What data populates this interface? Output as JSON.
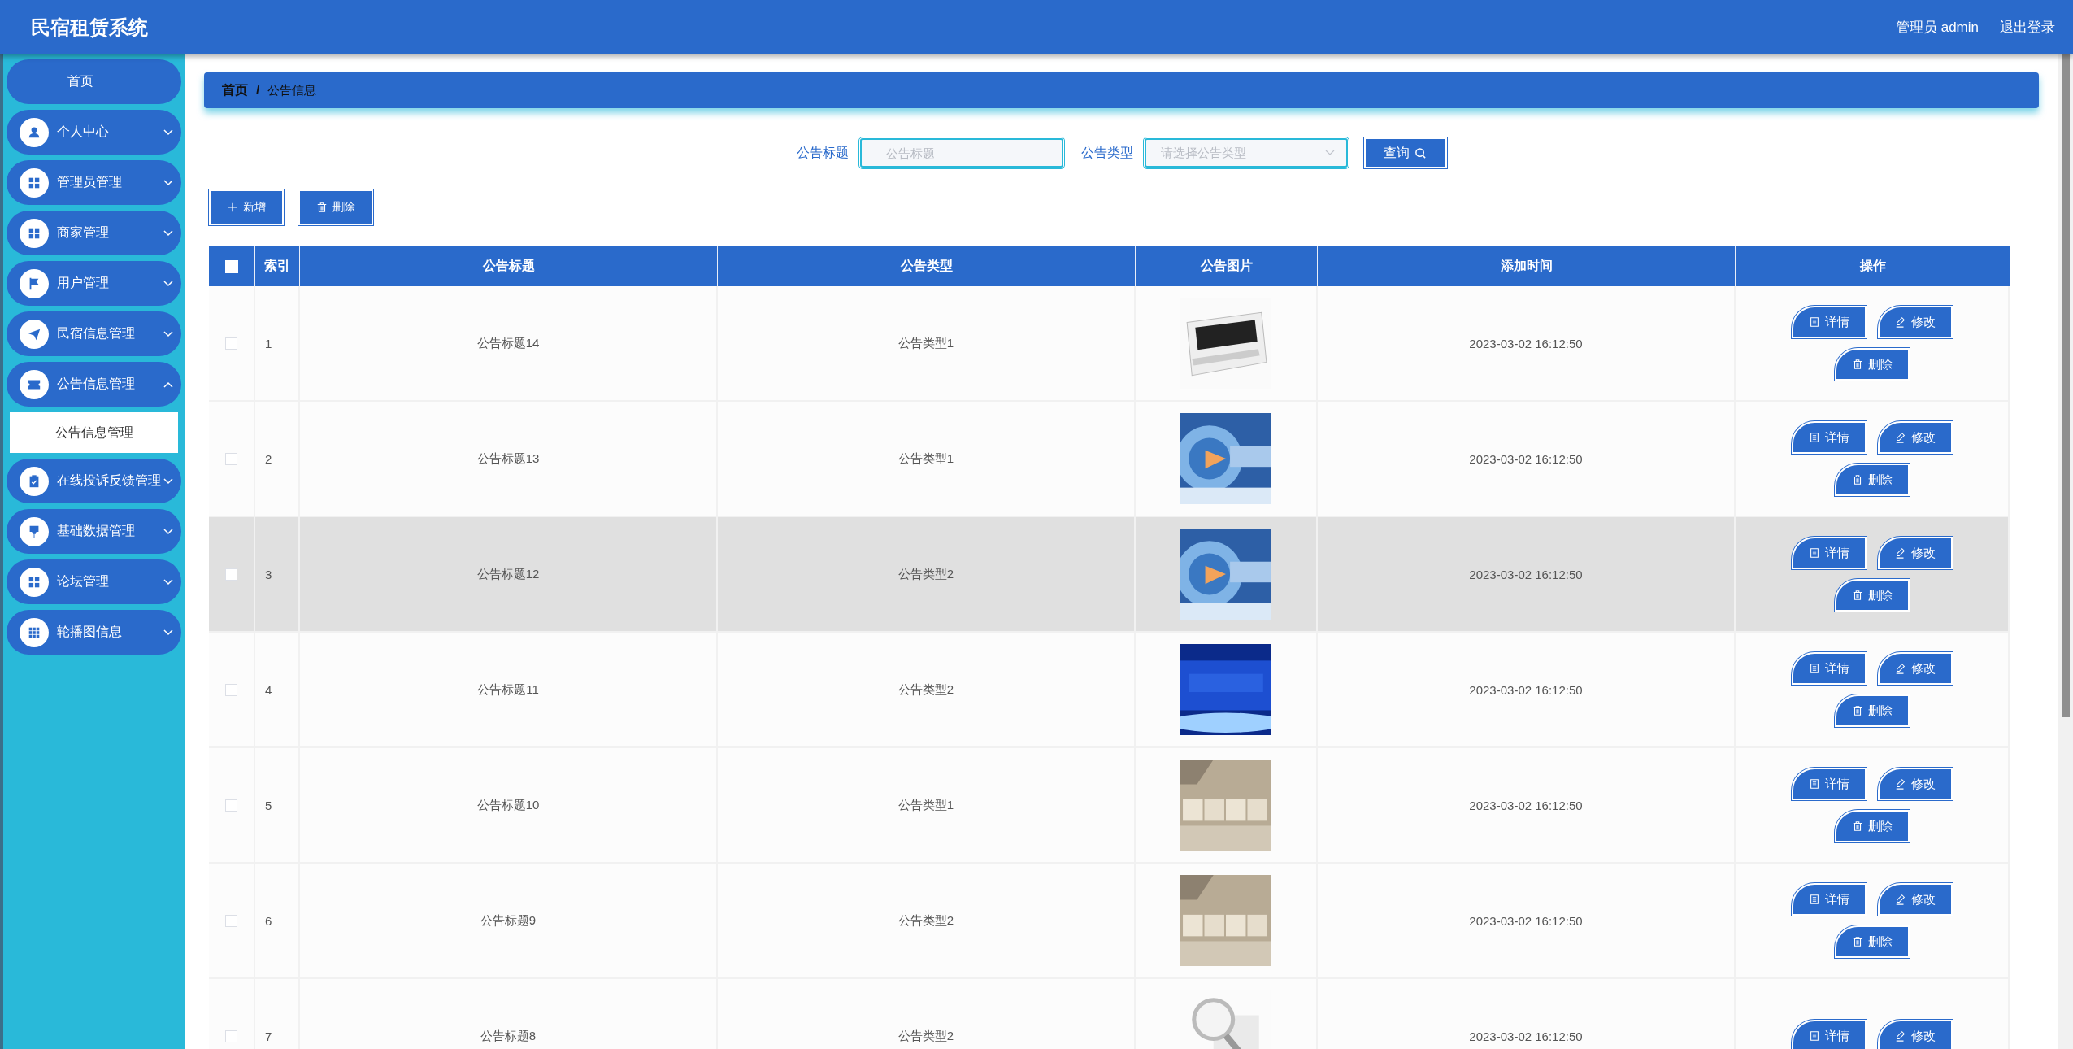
{
  "header": {
    "title": "民宿租赁系统",
    "user": "管理员 admin",
    "logout": "退出登录"
  },
  "sidebar": {
    "items": [
      {
        "kind": "link",
        "label": "首页"
      },
      {
        "kind": "menu",
        "label": "个人中心",
        "expanded": false
      },
      {
        "kind": "menu",
        "label": "管理员管理",
        "expanded": false
      },
      {
        "kind": "menu",
        "label": "商家管理",
        "expanded": false
      },
      {
        "kind": "menu",
        "label": "用户管理",
        "expanded": false
      },
      {
        "kind": "menu",
        "label": "民宿信息管理",
        "expanded": false
      },
      {
        "kind": "menu",
        "label": "公告信息管理",
        "expanded": true,
        "children": [
          {
            "label": "公告信息管理",
            "selected": true
          }
        ]
      },
      {
        "kind": "menu",
        "label": "在线投诉反馈管理",
        "expanded": false
      },
      {
        "kind": "menu",
        "label": "基础数据管理",
        "expanded": false
      },
      {
        "kind": "menu",
        "label": "论坛管理",
        "expanded": false
      },
      {
        "kind": "menu",
        "label": "轮播图信息",
        "expanded": false
      }
    ]
  },
  "breadcrumb": {
    "home": "首页",
    "separator": "/",
    "current": "公告信息"
  },
  "search": {
    "fields": [
      {
        "kind": "input",
        "label": "公告标题",
        "placeholder": "公告标题"
      },
      {
        "kind": "select",
        "label": "公告类型",
        "placeholder": "请选择公告类型"
      }
    ],
    "button": "查询"
  },
  "actions": [
    {
      "kind": "add",
      "label": "新增"
    },
    {
      "kind": "delete",
      "label": "删除"
    }
  ],
  "table": {
    "select_all": {
      "checked": false
    },
    "columns": [
      "索引",
      "公告标题",
      "公告类型",
      "公告图片",
      "添加时间",
      "操作"
    ],
    "rows": [
      {
        "checked": false,
        "hovered": false,
        "index": "1",
        "title": "公告标题14",
        "type": "公告类型1",
        "time": "2023-03-02 16:12:50",
        "actions": [
          {
            "kind": "detail",
            "label": "详情"
          },
          {
            "kind": "edit",
            "label": "修改"
          },
          {
            "kind": "delete",
            "label": "删除"
          }
        ]
      },
      {
        "checked": false,
        "hovered": false,
        "index": "2",
        "title": "公告标题13",
        "type": "公告类型1",
        "time": "2023-03-02 16:12:50",
        "actions": [
          {
            "kind": "detail",
            "label": "详情"
          },
          {
            "kind": "edit",
            "label": "修改"
          },
          {
            "kind": "delete",
            "label": "删除"
          }
        ]
      },
      {
        "checked": false,
        "hovered": true,
        "index": "3",
        "title": "公告标题12",
        "type": "公告类型2",
        "time": "2023-03-02 16:12:50",
        "actions": [
          {
            "kind": "detail",
            "label": "详情"
          },
          {
            "kind": "edit",
            "label": "修改"
          },
          {
            "kind": "delete",
            "label": "删除"
          }
        ]
      },
      {
        "checked": false,
        "hovered": false,
        "index": "4",
        "title": "公告标题11",
        "type": "公告类型2",
        "time": "2023-03-02 16:12:50",
        "actions": [
          {
            "kind": "detail",
            "label": "详情"
          },
          {
            "kind": "edit",
            "label": "修改"
          },
          {
            "kind": "delete",
            "label": "删除"
          }
        ]
      },
      {
        "checked": false,
        "hovered": false,
        "index": "5",
        "title": "公告标题10",
        "type": "公告类型1",
        "time": "2023-03-02 16:12:50",
        "actions": [
          {
            "kind": "detail",
            "label": "详情"
          },
          {
            "kind": "edit",
            "label": "修改"
          },
          {
            "kind": "delete",
            "label": "删除"
          }
        ]
      },
      {
        "checked": false,
        "hovered": false,
        "index": "6",
        "title": "公告标题9",
        "type": "公告类型2",
        "time": "2023-03-02 16:12:50",
        "actions": [
          {
            "kind": "detail",
            "label": "详情"
          },
          {
            "kind": "edit",
            "label": "修改"
          },
          {
            "kind": "delete",
            "label": "删除"
          }
        ]
      },
      {
        "checked": false,
        "hovered": false,
        "index": "7",
        "title": "公告标题8",
        "type": "公告类型2",
        "time": "2023-03-02 16:12:50",
        "actions": [
          {
            "kind": "detail",
            "label": "详情"
          },
          {
            "kind": "edit",
            "label": "修改"
          }
        ]
      }
    ]
  }
}
